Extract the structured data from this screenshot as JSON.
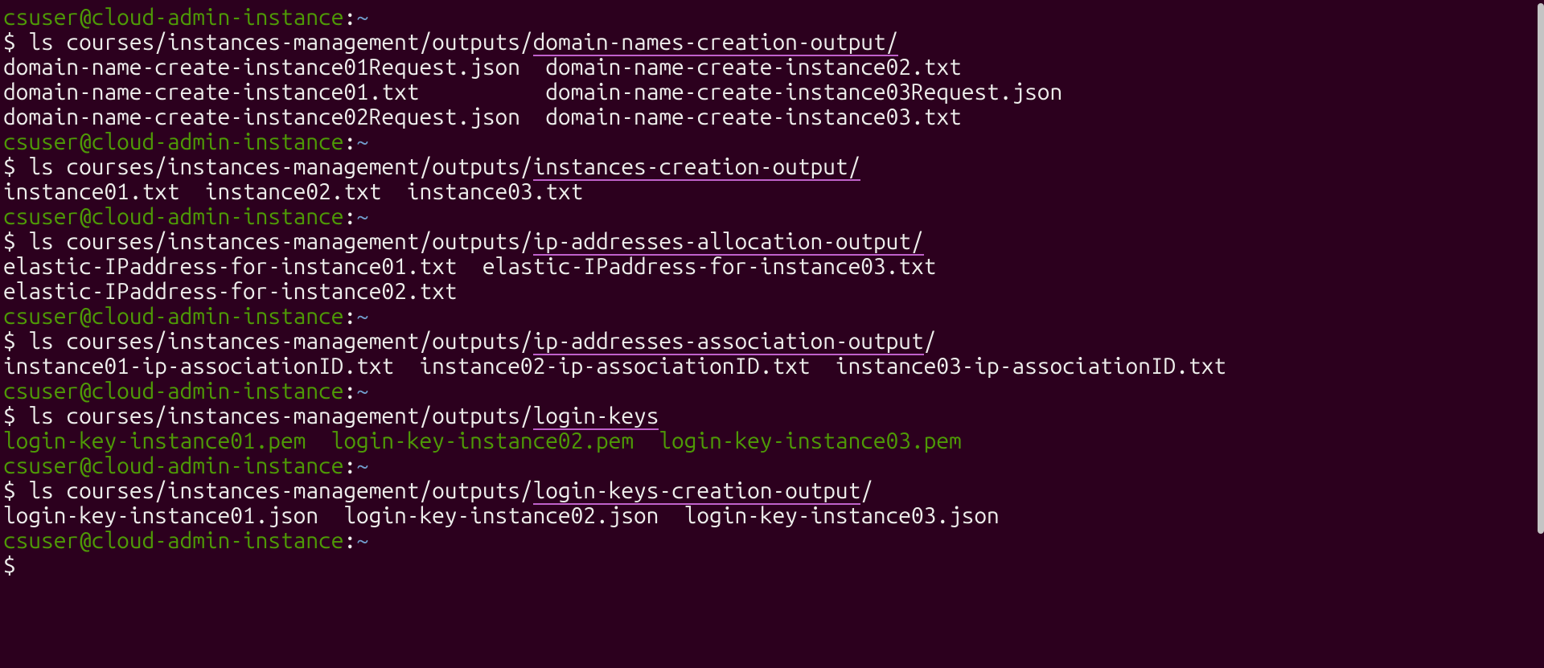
{
  "prompt": {
    "user": "csuser",
    "at": "@",
    "host": "cloud-admin-instance",
    "colon": ":",
    "tilde": "~",
    "dollar_prompt": "$ ",
    "dollar_only": "$"
  },
  "cmd_prefix": "ls courses/instances-management/outputs/",
  "sections": [
    {
      "argument": "domain-names-creation-output/",
      "underline_leading_space": true,
      "output_lines": [
        [
          {
            "text": "domain-name-create-instance01Request.json  ",
            "class": "text"
          },
          {
            "text": "domain-name-create-instance02.txt",
            "class": "text"
          }
        ],
        [
          {
            "text": "domain-name-create-instance01.txt          ",
            "class": "text"
          },
          {
            "text": "domain-name-create-instance03Request.json",
            "class": "text"
          }
        ],
        [
          {
            "text": "domain-name-create-instance02Request.json  ",
            "class": "text"
          },
          {
            "text": "domain-name-create-instance03.txt",
            "class": "text"
          }
        ]
      ]
    },
    {
      "argument": "instances-creation-output/",
      "underline_leading_space": true,
      "output_lines": [
        [
          {
            "text": "instance01.txt  instance02.txt  instance03.txt",
            "class": "text"
          }
        ]
      ]
    },
    {
      "argument": "ip-addresses-allocation-output/",
      "underline_leading_space": true,
      "output_lines": [
        [
          {
            "text": "elastic-IPaddress-for-instance01.txt  elastic-IPaddress-for-instance03.txt",
            "class": "text"
          }
        ],
        [
          {
            "text": "elastic-IPaddress-for-instance02.txt",
            "class": "text"
          }
        ]
      ]
    },
    {
      "argument": "ip-addresses-association-output",
      "trailing_after_ul": "/",
      "underline_leading_space": true,
      "output_lines": [
        [
          {
            "text": "instance01-ip-associationID.txt  instance02-ip-associationID.txt  instance03-ip-associationID.txt",
            "class": "text"
          }
        ]
      ]
    },
    {
      "argument": "login-keys",
      "underline_leading_space": true,
      "output_lines": [
        [
          {
            "text": "login-key-instance01.pem  login-key-instance02.pem  login-key-instance03.pem",
            "class": "green-file"
          }
        ]
      ]
    },
    {
      "argument": "login-keys-creation-output",
      "trailing_after_ul": "/",
      "underline_leading_space": true,
      "output_lines": [
        [
          {
            "text": "login-key-instance01.json  login-key-instance02.json  login-key-instance03.json",
            "class": "text"
          }
        ]
      ]
    }
  ]
}
